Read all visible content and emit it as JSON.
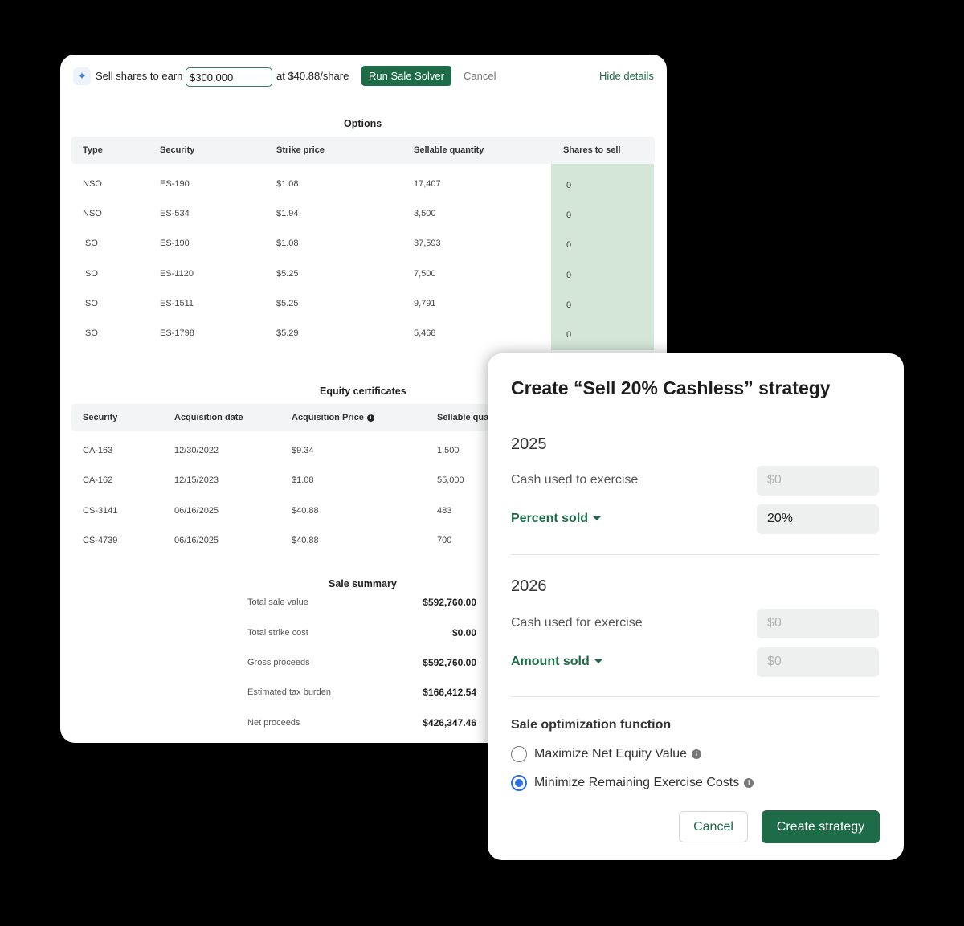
{
  "toolbar": {
    "prefix": "Sell shares to earn",
    "amount_value": "$300,000",
    "price_text": "at $40.88/share",
    "run_label": "Run Sale Solver",
    "cancel_label": "Cancel",
    "hide_label": "Hide details",
    "spark_icon": "sparkle-icon"
  },
  "options": {
    "title": "Options",
    "headers": [
      "Type",
      "Security",
      "Strike price",
      "Sellable quantity",
      "Shares to sell"
    ],
    "rows": [
      [
        "NSO",
        "ES-190",
        "$1.08",
        "17,407",
        "0"
      ],
      [
        "NSO",
        "ES-534",
        "$1.94",
        "3,500",
        "0"
      ],
      [
        "ISO",
        "ES-190",
        "$1.08",
        "37,593",
        "0"
      ],
      [
        "ISO",
        "ES-1120",
        "$5.25",
        "7,500",
        "0"
      ],
      [
        "ISO",
        "ES-1511",
        "$5.25",
        "9,791",
        "0"
      ],
      [
        "ISO",
        "ES-1798",
        "$5.29",
        "5,468",
        "0"
      ]
    ]
  },
  "equity": {
    "title": "Equity certificates",
    "headers": [
      "Security",
      "Acquisition date",
      "Acquisition Price",
      "Sellable quantity"
    ],
    "rows": [
      [
        "CA-163",
        "12/30/2022",
        "$9.34",
        "1,500"
      ],
      [
        "CA-162",
        "12/15/2023",
        "$1.08",
        "55,000"
      ],
      [
        "CS-3141",
        "06/16/2025",
        "$40.88",
        "483"
      ],
      [
        "CS-4739",
        "06/16/2025",
        "$40.88",
        "700"
      ]
    ]
  },
  "summary": {
    "title": "Sale summary",
    "rows": [
      {
        "label": "Total sale value",
        "value": "$592,760.00"
      },
      {
        "label": "Total strike cost",
        "value": "$0.00"
      },
      {
        "label": "Gross proceeds",
        "value": "$592,760.00"
      },
      {
        "label": "Estimated tax burden",
        "value": "$166,412.54"
      },
      {
        "label": "Net proceeds",
        "value": "$426,347.46"
      }
    ]
  },
  "modal": {
    "title": "Create “Sell 20% Cashless” strategy",
    "year1": {
      "year": "2025",
      "cash_label": "Cash used to exercise",
      "cash_value": "$0",
      "dropdown_label": "Percent sold",
      "dropdown_value": "20%"
    },
    "year2": {
      "year": "2026",
      "cash_label": "Cash used for exercise",
      "cash_value": "$0",
      "dropdown_label": "Amount sold",
      "dropdown_value": "$0"
    },
    "optimization": {
      "label": "Sale optimization function",
      "option1": "Maximize Net Equity Value",
      "option2": "Minimize Remaining Exercise Costs",
      "selected": "option2"
    },
    "cancel_label": "Cancel",
    "create_label": "Create strategy"
  },
  "colors": {
    "accent_green": "#1e6b48",
    "shares_bg": "#d3e6d8",
    "radio_blue": "#2d6fe0"
  }
}
